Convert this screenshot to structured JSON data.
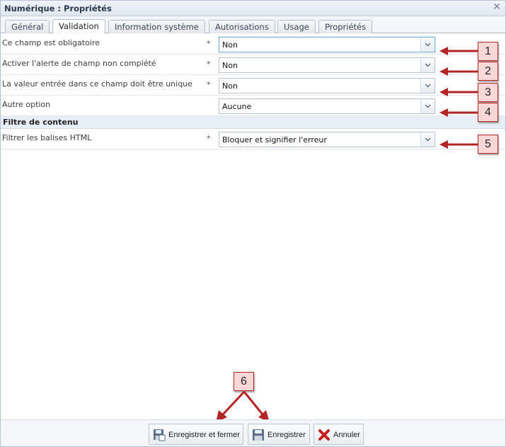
{
  "window": {
    "title": "Numérique : Propriétés"
  },
  "tabs": [
    {
      "label": "Général",
      "active": false
    },
    {
      "label": "Validation",
      "active": true
    },
    {
      "label": "Information système",
      "active": false
    },
    {
      "label": "Autorisations",
      "active": false
    },
    {
      "label": "Usage",
      "active": false
    },
    {
      "label": "Propriétés",
      "active": false
    }
  ],
  "form": {
    "fields": [
      {
        "label": "Ce champ est obligatoire",
        "required_mark": "*",
        "value": "Non"
      },
      {
        "label": "Activer l'alerte de champ non complété",
        "required_mark": "*",
        "value": "Non"
      },
      {
        "label": "La valeur entrée dans ce champ doit être unique",
        "required_mark": "*",
        "value": "Non"
      },
      {
        "label": "Autre option",
        "required_mark": "",
        "value": "Aucune"
      }
    ],
    "section_title": "Filtre de contenu",
    "filter_field": {
      "label": "Filtrer les balises HTML",
      "required_mark": "*",
      "value": "Bloquer et signifier l'erreur"
    }
  },
  "annotations": [
    "1",
    "2",
    "3",
    "4",
    "5",
    "6"
  ],
  "annotation_color": "#b32424",
  "footer": {
    "save_close_label": "Enregistrer et fermer",
    "save_label": "Enregistrer",
    "cancel_label": "Annuler"
  }
}
